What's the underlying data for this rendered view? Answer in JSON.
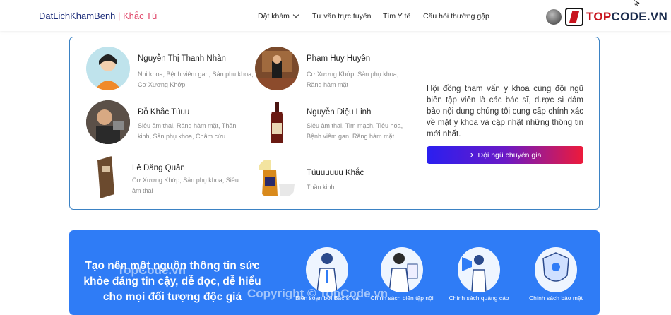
{
  "header": {
    "brand_main": "DatLichKhamBenh",
    "brand_separator": " | ",
    "brand_author": "Khắc Tú",
    "nav": [
      "Đặt khám",
      "Tư vấn trực tuyến",
      "Tìm Y tế",
      "Câu hỏi thường gặp"
    ],
    "logo_part1": "TOP",
    "logo_part2": "CODE.VN"
  },
  "experts": [
    {
      "name": "Nguyễn Thị Thanh Nhàn",
      "specialties": "Nhi khoa, Bệnh viêm gan, Sản phụ khoa, Cơ Xương Khớp"
    },
    {
      "name": "Phạm Huy Huyên",
      "specialties": "Cơ Xương Khớp, Sản phụ khoa, Răng hàm mặt"
    },
    {
      "name": "Đỗ Khắc Túuu",
      "specialties": "Siêu âm thai, Răng hàm mặt, Thần kinh, Sản phụ khoa, Châm cứu"
    },
    {
      "name": "Nguyễn Diệu Linh",
      "specialties": "Siêu âm thai, Tim mạch, Tiêu hóa, Bệnh viêm gan, Răng hàm mặt"
    },
    {
      "name": "Lê Đăng Quân",
      "specialties": "Cơ Xương Khớp, Sản phụ khoa, Siêu âm thai"
    },
    {
      "name": "Túuuuuuu Khắc",
      "specialties": "Thần kinh"
    }
  ],
  "council": {
    "text": "Hội đồng tham vấn y khoa cùng đội ngũ biên tập viên là các bác sĩ, dược sĩ đảm bảo nội dung chúng tôi cung cấp chính xác về mặt y khoa và cập nhật những thông tin mới nhất.",
    "button": "Đội ngũ chuyên gia"
  },
  "mission": {
    "headline": "Tạo nên một nguồn thông tin sức khỏe đáng tin cậy, dễ đọc, dễ hiểu cho mọi đối tượng độc giả",
    "policies": [
      "Biên soạn bởi Bác sĩ và",
      "Chính sách biên tập nội",
      "Chính sách quảng cáo",
      "Chính sách bảo mật"
    ]
  },
  "watermarks": [
    "TopCode.vn",
    "Copyright © TopCode.vn"
  ],
  "colors": {
    "brand": "#1d2d7a",
    "accent": "#e0476a",
    "panel_border": "#3b82c4",
    "mission_bg": "#2f7cf6"
  }
}
